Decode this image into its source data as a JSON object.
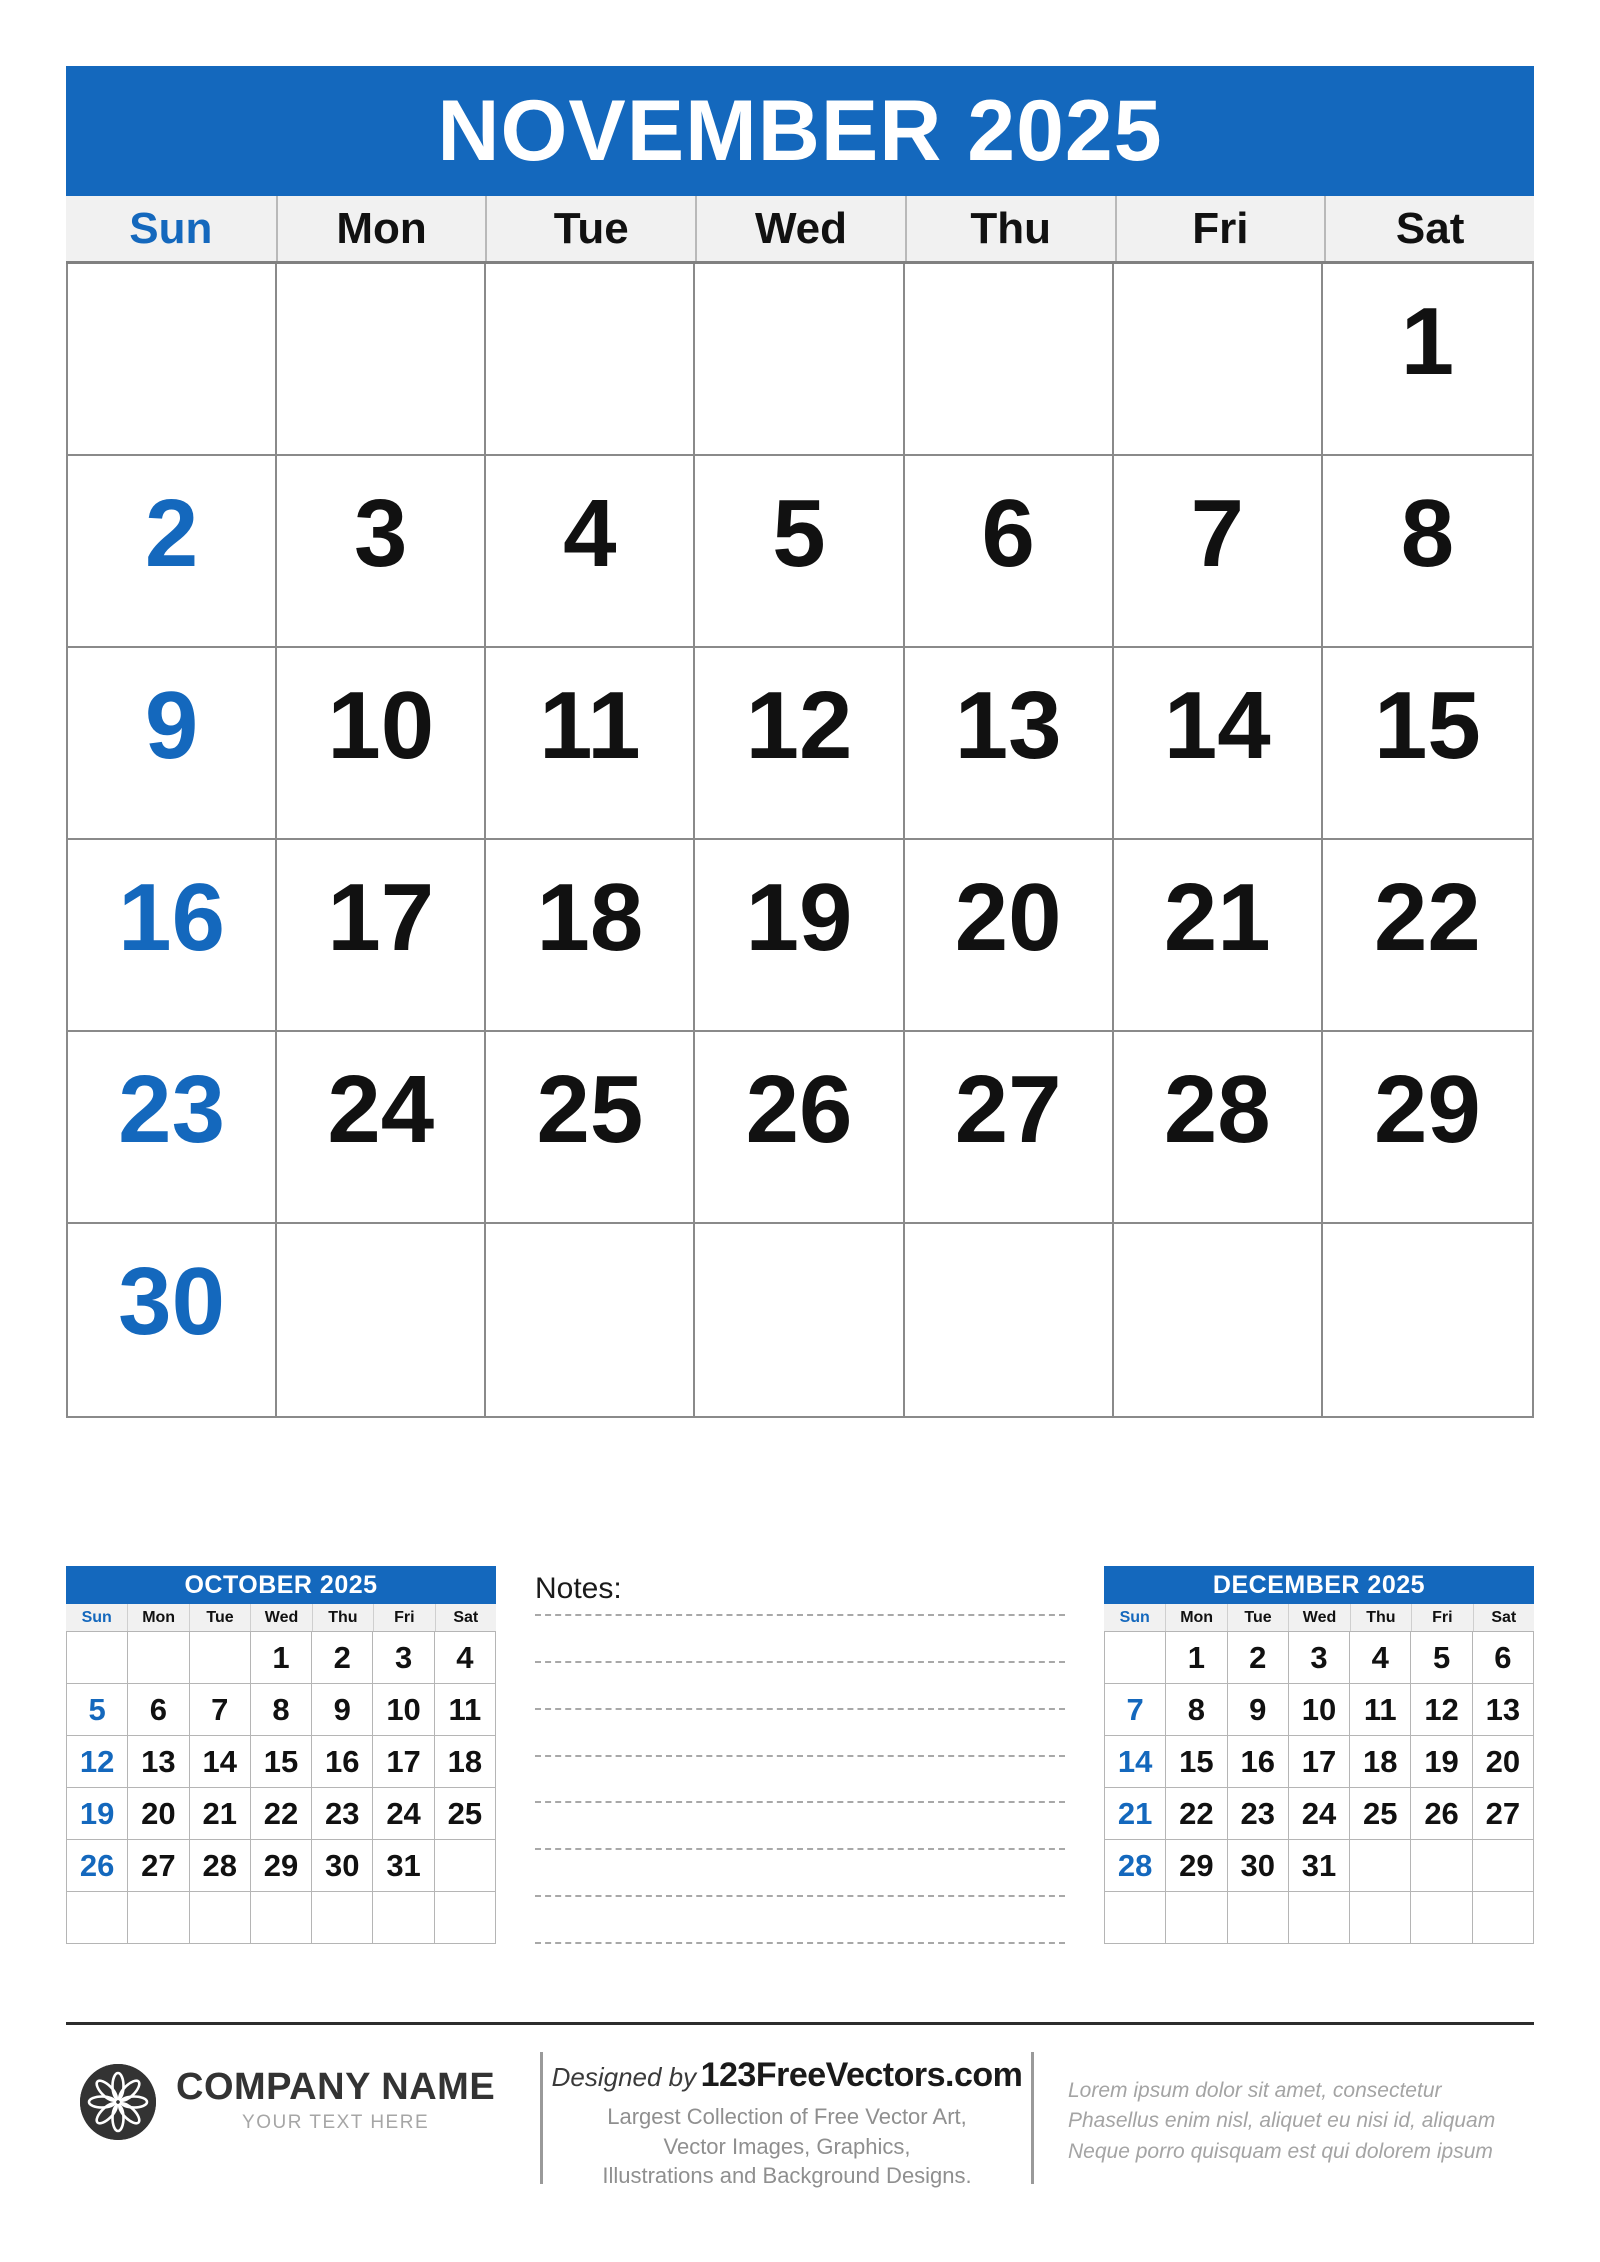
{
  "main_month": {
    "title": "NOVEMBER 2025",
    "weekdays": [
      "Sun",
      "Mon",
      "Tue",
      "Wed",
      "Thu",
      "Fri",
      "Sat"
    ],
    "cells": [
      "",
      "",
      "",
      "",
      "",
      "",
      "1",
      "2",
      "3",
      "4",
      "5",
      "6",
      "7",
      "8",
      "9",
      "10",
      "11",
      "12",
      "13",
      "14",
      "15",
      "16",
      "17",
      "18",
      "19",
      "20",
      "21",
      "22",
      "23",
      "24",
      "25",
      "26",
      "27",
      "28",
      "29",
      "30",
      "",
      "",
      "",
      "",
      "",
      ""
    ]
  },
  "prev_month": {
    "title": "OCTOBER 2025",
    "weekdays": [
      "Sun",
      "Mon",
      "Tue",
      "Wed",
      "Thu",
      "Fri",
      "Sat"
    ],
    "cells": [
      "",
      "",
      "",
      "1",
      "2",
      "3",
      "4",
      "5",
      "6",
      "7",
      "8",
      "9",
      "10",
      "11",
      "12",
      "13",
      "14",
      "15",
      "16",
      "17",
      "18",
      "19",
      "20",
      "21",
      "22",
      "23",
      "24",
      "25",
      "26",
      "27",
      "28",
      "29",
      "30",
      "31",
      "",
      "",
      "",
      "",
      "",
      "",
      "",
      ""
    ]
  },
  "next_month": {
    "title": "DECEMBER 2025",
    "weekdays": [
      "Sun",
      "Mon",
      "Tue",
      "Wed",
      "Thu",
      "Fri",
      "Sat"
    ],
    "cells": [
      "",
      "1",
      "2",
      "3",
      "4",
      "5",
      "6",
      "7",
      "8",
      "9",
      "10",
      "11",
      "12",
      "13",
      "14",
      "15",
      "16",
      "17",
      "18",
      "19",
      "20",
      "21",
      "22",
      "23",
      "24",
      "25",
      "26",
      "27",
      "28",
      "29",
      "30",
      "31",
      "",
      "",
      "",
      "",
      "",
      "",
      "",
      "",
      "",
      ""
    ]
  },
  "notes": {
    "label": "Notes:",
    "line_count": 8
  },
  "footer": {
    "logo_icon": "flower-logo-icon",
    "company_name": "COMPANY NAME",
    "company_sub": "YOUR TEXT HERE",
    "designed_by": "Designed by",
    "designed_site": "123FreeVectors.com",
    "designed_desc": [
      "Largest Collection of Free Vector Art,",
      "Vector Images, Graphics,",
      "Illustrations and Background Designs."
    ],
    "lorem": [
      "Lorem ipsum dolor sit amet, consectetur",
      "Phasellus enim nisl, aliquet eu nisi id, aliquam",
      "Neque porro quisquam est qui dolorem ipsum"
    ]
  },
  "colors": {
    "accent_blue": "#1468bd",
    "header_text": "#ffffff",
    "dow_bg": "#f1f1f1",
    "grid_line": "#8a8a8a",
    "muted_text": "#a4a4a4"
  }
}
